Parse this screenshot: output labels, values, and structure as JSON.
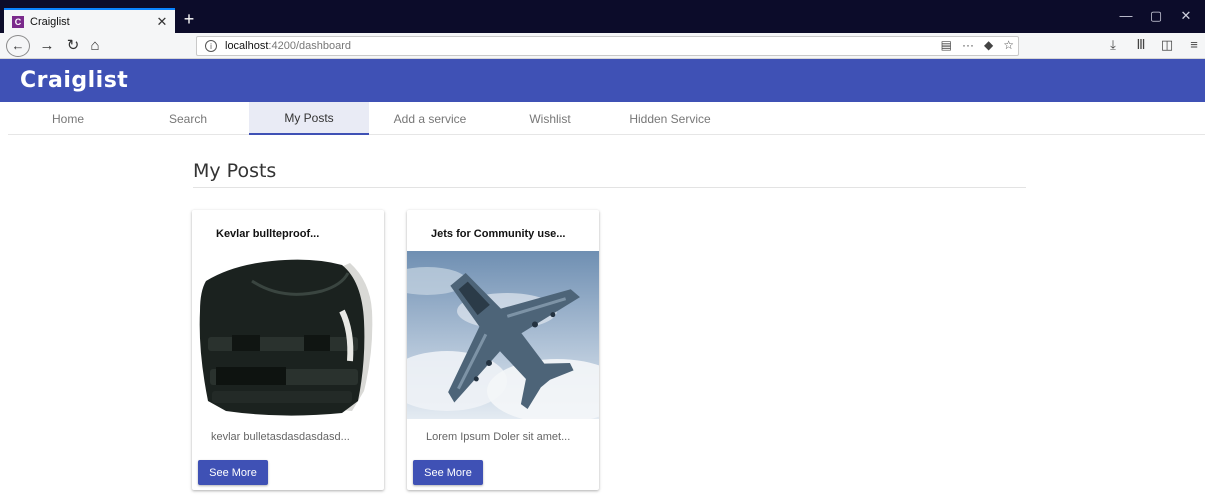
{
  "browser": {
    "tab_title": "Craiglist",
    "tab_favicon": "C",
    "tab_close": "✕",
    "new_tab": "+",
    "url_host": "localhost",
    "url_path": ":4200/dashboard",
    "window_controls": [
      "—",
      "▢",
      "✕"
    ],
    "icons": [
      "back-arrow-icon",
      "forward-arrow-icon",
      "reload-icon",
      "home-icon",
      "reader-view-icon",
      "page-actions-icon",
      "pocket-icon",
      "bookmark-star-icon",
      "downloads-icon",
      "library-icon",
      "sidebar-icon",
      "menu-icon"
    ]
  },
  "app": {
    "logo": "Craiglist",
    "accent_color": "#3f51b5",
    "tabs": [
      {
        "label": "Home"
      },
      {
        "label": "Search"
      },
      {
        "label": "My Posts"
      },
      {
        "label": "Add a service"
      },
      {
        "label": "Wishlist"
      },
      {
        "label": "Hidden Service"
      }
    ],
    "active_tab": "My Posts"
  },
  "page": {
    "title": "My Posts",
    "posts": [
      {
        "title": "Kevlar bullteproof...",
        "description": "kevlar bulletasdasdasdasd...",
        "button": "See More",
        "image": "bulletproof-vest"
      },
      {
        "title": "Jets for Community use...",
        "description": "Lorem Ipsum Doler sit amet...",
        "button": "See More",
        "image": "fighter-jet"
      }
    ]
  }
}
